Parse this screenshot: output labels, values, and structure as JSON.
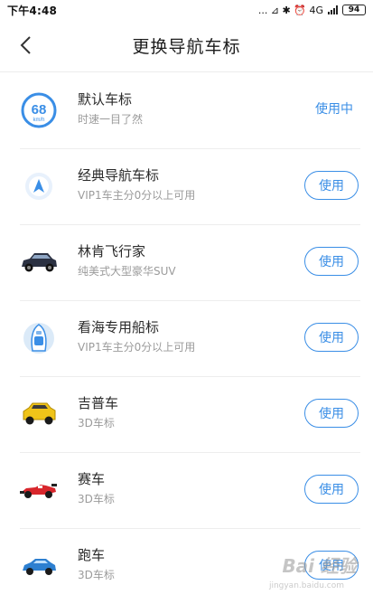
{
  "status_bar": {
    "time": "下午4:48",
    "indicators": "... ⊿ ✱ ⏰ 4G",
    "battery": "94"
  },
  "header": {
    "title": "更换导航车标",
    "back_icon": "chevron-left-icon"
  },
  "items": [
    {
      "title": "默认车标",
      "subtitle": "时速一目了然",
      "icon": "speedometer-icon",
      "action": "使用中",
      "in_use": true,
      "speed": "68",
      "unit": "km/h"
    },
    {
      "title": "经典导航车标",
      "subtitle": "VIP1车主分0分以上可用",
      "icon": "navigation-arrow-icon",
      "action": "使用",
      "in_use": false
    },
    {
      "title": "林肯飞行家",
      "subtitle": "纯美式大型豪华SUV",
      "icon": "suv-car-icon",
      "action": "使用",
      "in_use": false
    },
    {
      "title": "看海专用船标",
      "subtitle": "VIP1车主分0分以上可用",
      "icon": "boat-icon",
      "action": "使用",
      "in_use": false
    },
    {
      "title": "吉普车",
      "subtitle": "3D车标",
      "icon": "jeep-icon",
      "action": "使用",
      "in_use": false
    },
    {
      "title": "赛车",
      "subtitle": "3D车标",
      "icon": "race-car-icon",
      "action": "使用",
      "in_use": false
    },
    {
      "title": "跑车",
      "subtitle": "3D车标",
      "icon": "sports-car-icon",
      "action": "使用",
      "in_use": false
    }
  ],
  "colors": {
    "accent": "#3a8ee6",
    "jeep": "#f0c419",
    "race_car": "#d8262c",
    "sports_car": "#2d7fd0",
    "suv": "#2b3142"
  },
  "watermark": {
    "brand": "Bai 经验",
    "sub": "jingyan.baidu.com"
  }
}
